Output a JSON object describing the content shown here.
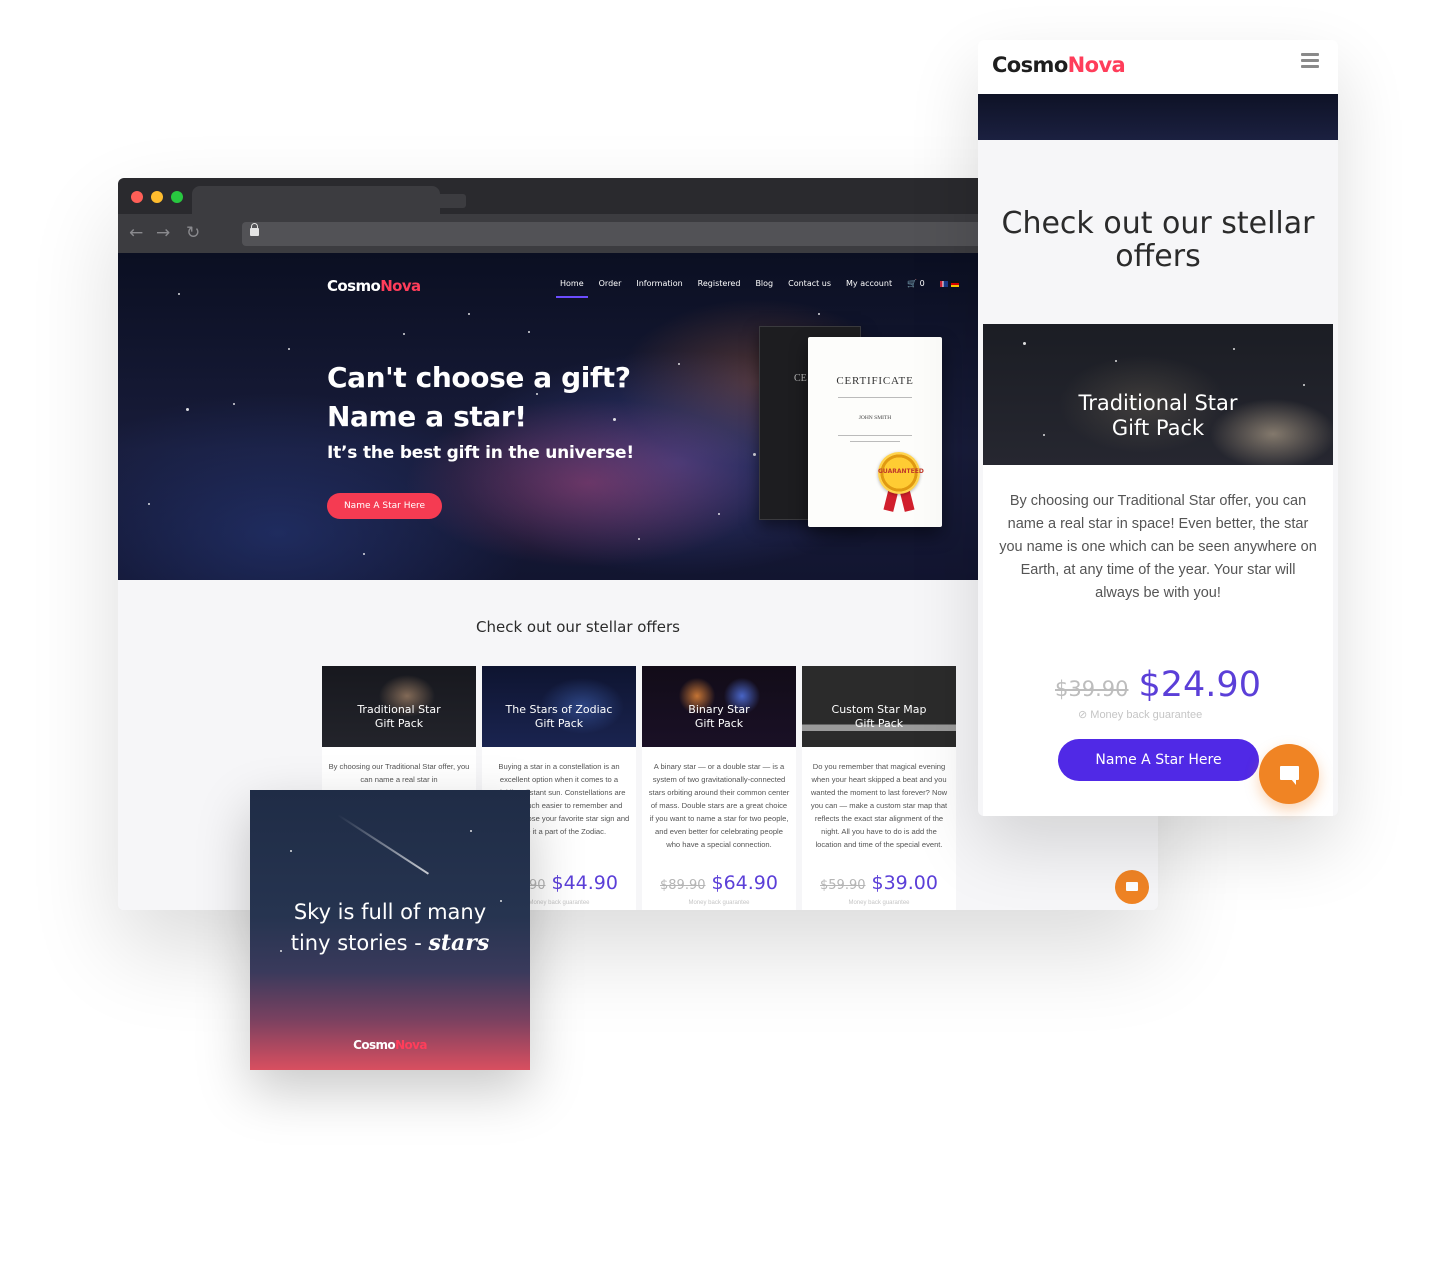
{
  "desktop": {
    "logo": {
      "part1": "Cosmo",
      "part2": "Nova"
    },
    "menu": [
      "Home",
      "Order",
      "Information",
      "Registered",
      "Blog",
      "Contact us",
      "My account"
    ],
    "cart_count": "0",
    "hero": {
      "title_line1": "Can't choose a gift?",
      "title_line2": "Name a star!",
      "subtitle": "It’s the best gift in the universe!",
      "button": "Name A Star Here"
    },
    "certificate": {
      "back_text": "CE",
      "title": "CERTIFICATE",
      "name": "JOHN SMITH",
      "seal": "GUARANTEED"
    },
    "offers_title": "Check out our stellar offers",
    "cards": [
      {
        "title1": "Traditional Star",
        "title2": "Gift Pack",
        "text": "By choosing our Traditional Star offer, you can name a real star in",
        "old_price": "",
        "new_price": "",
        "guarantee": ""
      },
      {
        "title1": "The Stars of Zodiac",
        "title2": "Gift Pack",
        "text": "Buying a star in a constellation is an excellent option when it comes to a twinkling distant sun. Constellations are always much easier to remember and find, so choose your favorite star sign and make it a part of the Zodiac.",
        "old_price": "$59.90",
        "new_price": "$44.90",
        "guarantee": "Money back guarantee"
      },
      {
        "title1": "Binary Star",
        "title2": "Gift Pack",
        "text": "A binary star — or a double star — is a system of two gravitationally-connected stars orbiting around their common center of mass. Double stars are a great choice if you want to name a star for two people, and even better for celebrating people who have a special connection.",
        "old_price": "$89.90",
        "new_price": "$64.90",
        "guarantee": "Money back guarantee"
      },
      {
        "title1": "Custom Star Map",
        "title2": "Gift Pack",
        "text": "Do you remember that magical evening when your heart skipped a beat and you wanted the moment to last forever? Now you can — make a custom star map that reflects the exact star alignment of the night. All you have to do is add the location and time of the special event.",
        "old_price": "$59.90",
        "new_price": "$39.00",
        "guarantee": "Money back guarantee"
      }
    ]
  },
  "social": {
    "line1": "Sky is full of many",
    "line2": "tiny stories -",
    "script_word": "stars",
    "logo_part1": "Cosmo",
    "logo_part2": "Nova"
  },
  "mobile": {
    "logo": {
      "part1": "Cosmo",
      "part2": "Nova"
    },
    "title_line1": "Check out our stellar",
    "title_line2": "offers",
    "card": {
      "title1": "Traditional Star",
      "title2": "Gift Pack",
      "text": "By choosing our Traditional Star offer, you can name a real star in space! Even better, the star you name is one which can be seen anywhere on Earth, at any time of the year. Your star will always be with you!",
      "old_price": "$39.90",
      "new_price": "$24.90",
      "guarantee": "Money back guarantee",
      "button": "Name A Star Here"
    }
  },
  "icons": [
    "back-icon",
    "forward-icon",
    "reload-icon",
    "lock-icon",
    "cart-icon",
    "flag-uk-icon",
    "flag-de-icon",
    "menu-icon",
    "chat-icon",
    "check-icon"
  ],
  "colors": {
    "brand_red": "#ff3d5a",
    "cta_red": "#f53b52",
    "price_purple": "#5b3fd8",
    "button_purple": "#5029e6",
    "chat_orange": "#f08424"
  }
}
